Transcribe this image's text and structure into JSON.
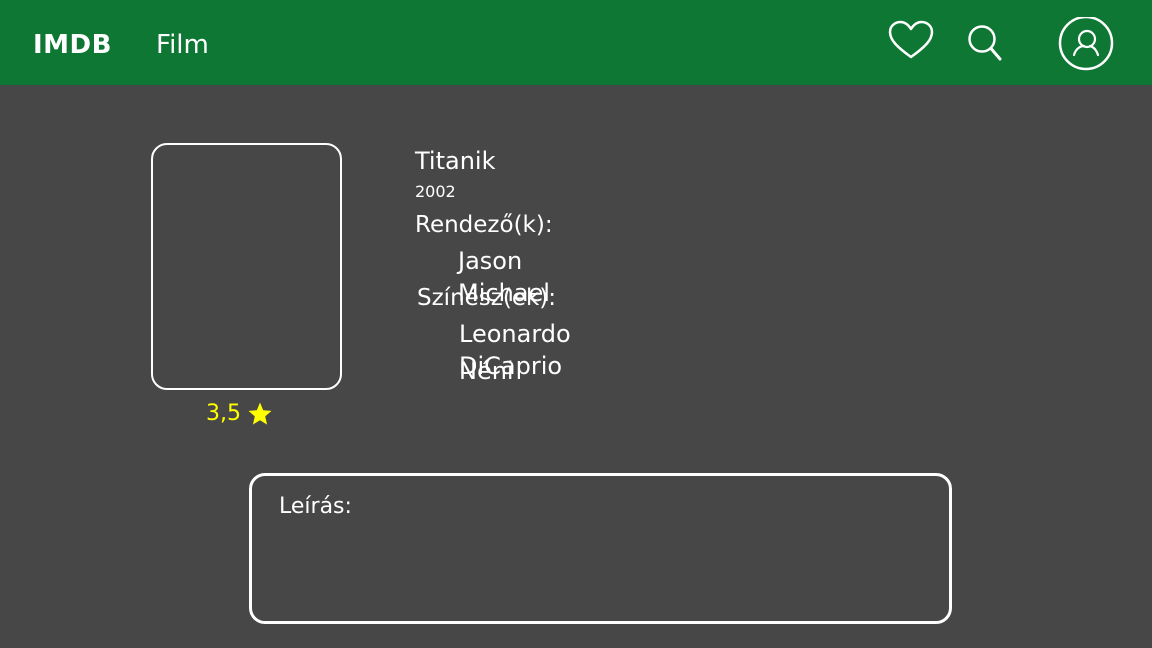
{
  "header": {
    "brand": "IMDB",
    "nav_film": "Film",
    "icons": [
      "heart-icon",
      "search-icon",
      "user-icon"
    ],
    "background_color": "#0e7733"
  },
  "movie": {
    "title": "Titanik",
    "year": "2002",
    "directors_label": "Rendező(k):",
    "directors": [
      "Jason Michael"
    ],
    "actors_label": "Színész(ek):",
    "actors": [
      "Leonardo DiCaprio",
      "Néni"
    ],
    "rating": "3,5",
    "rating_color": "#ffff00"
  },
  "description": {
    "label": "Leírás:"
  },
  "page": {
    "background_color": "#474747"
  }
}
